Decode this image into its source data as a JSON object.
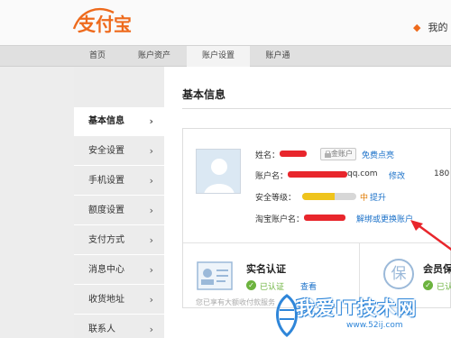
{
  "header": {
    "logo_text": "支付宝",
    "user_link": "我的"
  },
  "nav": {
    "tabs": [
      {
        "label": "首页",
        "active": false
      },
      {
        "label": "账户资产",
        "active": false
      },
      {
        "label": "账户设置",
        "active": true
      },
      {
        "label": "账户通",
        "active": false
      }
    ]
  },
  "sidebar": {
    "items": [
      {
        "label": "基本信息",
        "active": true
      },
      {
        "label": "安全设置",
        "active": false
      },
      {
        "label": "手机设置",
        "active": false
      },
      {
        "label": "额度设置",
        "active": false
      },
      {
        "label": "支付方式",
        "active": false
      },
      {
        "label": "消息中心",
        "active": false
      },
      {
        "label": "收货地址",
        "active": false
      },
      {
        "label": "联系人",
        "active": false
      }
    ],
    "chevron": "›"
  },
  "main": {
    "title": "基本信息",
    "profile": {
      "name_label": "姓名：",
      "badge_text": "金账户",
      "badge_link": "免费点亮",
      "account_label": "账户名：",
      "account_suffix": "qq.com",
      "account_edit": "修改",
      "phone_partial": "180",
      "security_label": "安全等级：",
      "security_level_text": "中",
      "security_level_fraction": 0.6,
      "security_upgrade": "提升",
      "taobao_label": "淘宝账户名：",
      "taobao_link": "解绑或更换账户"
    },
    "realname": {
      "title": "实名认证",
      "status": "已认证",
      "view_link": "查看",
      "footnote": "您已享有大额收付款服务"
    },
    "member": {
      "icon_char": "保",
      "title": "会员保",
      "status": "已认"
    }
  },
  "watermark": {
    "title": "我爱IT技术网",
    "url": "www.52ij.com"
  },
  "colors": {
    "brand_orange": "#ee6a1c",
    "link_blue": "#1b71c9",
    "redaction_red": "#e8262c",
    "level_yellow": "#efc41c",
    "success_green": "#6cb33e"
  },
  "icons": [
    "alipay-logo",
    "avatar-placeholder-icon",
    "lock-icon",
    "id-card-icon",
    "check-icon",
    "insurance-icon",
    "annotation-arrow"
  ]
}
